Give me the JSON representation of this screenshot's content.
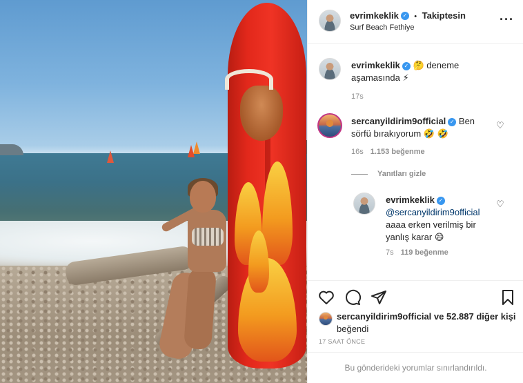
{
  "post": {
    "author": "evrimkeklik",
    "follow_status": "Takiptesin",
    "separator": "•",
    "location": "Surf Beach Fethiye",
    "more_icon": "more-horizontal-icon"
  },
  "comments": [
    {
      "username": "evrimkeklik",
      "verified": true,
      "text_before": "deneme aşamasında",
      "emoji_1": "🤔",
      "emoji_2": "⚡",
      "time": "17s"
    },
    {
      "username": "sercanyildirim9official",
      "verified": true,
      "text": "Ben sörfü bırakıyorum",
      "emoji_1": "🤣",
      "emoji_2": "🤣",
      "time": "16s",
      "likes": "1.153 beğenme",
      "hide_replies": "Yanıtları gizle"
    }
  ],
  "reply": {
    "username": "evrimkeklik",
    "verified": true,
    "mention": "@sercanyildirim9official",
    "text": "aaaa erken verilmiş bir yanlış karar",
    "emoji": "😄",
    "time": "7s",
    "likes": "119 beğenme"
  },
  "actions": {
    "like_icon": "heart-icon",
    "comment_icon": "comment-icon",
    "share_icon": "send-icon",
    "save_icon": "bookmark-icon"
  },
  "liked_by": {
    "user": "sercanyildirim9official",
    "rest": "ve 52.887 diğer kişi",
    "suffix": "beğendi"
  },
  "timestamp": "17 SAAT ÖNCE",
  "restricted_notice": "Bu gönderideki yorumlar sınırlandırıldı.",
  "colors": {
    "verified_blue": "#3897f0",
    "text": "#262626",
    "muted": "#8e8e8e",
    "board_red": "#e2281b"
  }
}
